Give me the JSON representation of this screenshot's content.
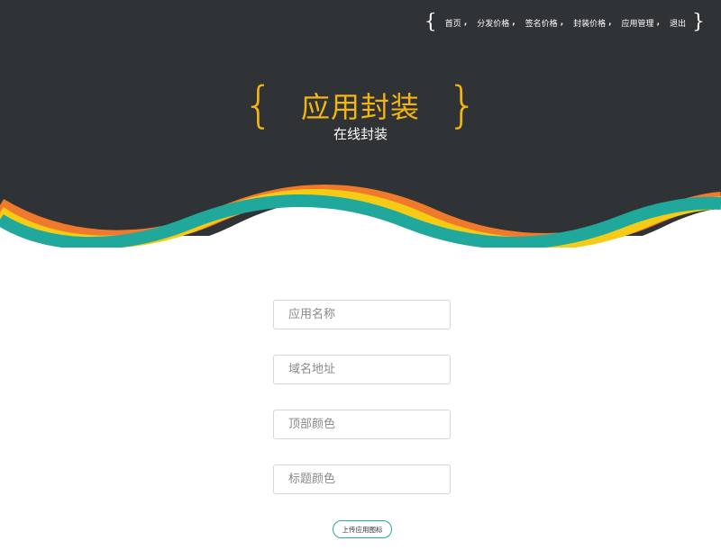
{
  "nav": {
    "items": [
      {
        "label": "首页"
      },
      {
        "label": "分发价格"
      },
      {
        "label": "签名价格"
      },
      {
        "label": "封装价格"
      },
      {
        "label": "应用管理"
      },
      {
        "label": "退出"
      }
    ],
    "separator": ",",
    "brace_open": "{",
    "brace_close": "}"
  },
  "hero": {
    "title": "应用封装",
    "subtitle": "在线封装",
    "brace_open": "{",
    "brace_close": "}"
  },
  "form": {
    "app_name_placeholder": "应用名称",
    "domain_placeholder": "域名地址",
    "top_color_placeholder": "顶部颜色",
    "title_color_placeholder": "标题颜色",
    "upload_label": "上传应用图标"
  },
  "colors": {
    "header_bg": "#303336",
    "accent_gold": "#f4b511",
    "wave_orange": "#f07a2b",
    "wave_yellow": "#f6cb15",
    "wave_teal": "#1fa89b"
  }
}
